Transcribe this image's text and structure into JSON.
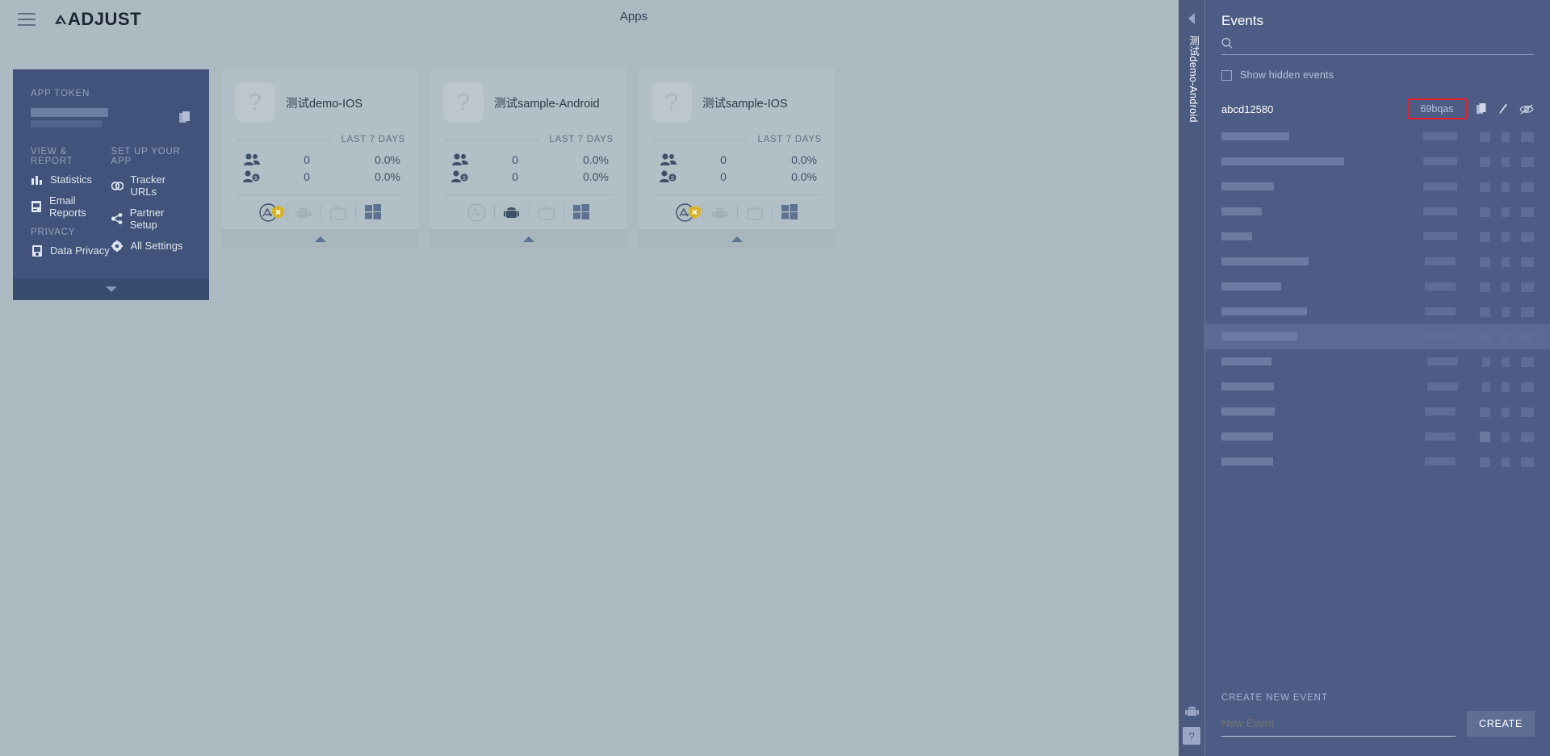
{
  "header": {
    "menu_icon": "hamburger-icon",
    "logo_text": "ADJUST",
    "page_title": "Apps"
  },
  "info_card": {
    "app_token_label": "APP TOKEN",
    "copy_icon": "copy-icon",
    "columns": [
      {
        "heading": "VIEW & REPORT",
        "items": [
          {
            "icon": "bar-chart-icon",
            "label": "Statistics"
          },
          {
            "icon": "email-report-icon",
            "label": "Email Reports"
          }
        ],
        "heading2": "PRIVACY",
        "items2": [
          {
            "icon": "data-privacy-icon",
            "label": "Data Privacy"
          }
        ]
      },
      {
        "heading": "SET UP YOUR APP",
        "items": [
          {
            "icon": "link-icon",
            "label": "Tracker URLs"
          },
          {
            "icon": "share-icon",
            "label": "Partner Setup"
          },
          {
            "icon": "gear-icon",
            "label": "All Settings"
          }
        ]
      }
    ],
    "expand_icon": "chevron-down-icon"
  },
  "apps": [
    {
      "name": "测试demo-IOS",
      "icon": "question-mark-placeholder-icon",
      "period": "LAST 7 DAYS",
      "stats": [
        {
          "icon": "users-icon",
          "value": "0",
          "percent": "0.0%"
        },
        {
          "icon": "paying-user-icon",
          "value": "0",
          "percent": "0.0%"
        }
      ],
      "platforms": [
        "app-store-icon",
        "android-icon",
        "amazon-store-icon",
        "windows-store-icon"
      ],
      "platform_warning": true,
      "expand_icon": "chevron-up-icon"
    },
    {
      "name": "测试sample-Android",
      "icon": "question-mark-placeholder-icon",
      "period": "LAST 7 DAYS",
      "stats": [
        {
          "icon": "users-icon",
          "value": "0",
          "percent": "0.0%"
        },
        {
          "icon": "paying-user-icon",
          "value": "0",
          "percent": "0.0%"
        }
      ],
      "platforms": [
        "app-store-icon",
        "android-icon",
        "amazon-store-icon",
        "windows-store-icon"
      ],
      "platform_warning": false,
      "expand_icon": "chevron-up-icon"
    },
    {
      "name": "测试sample-IOS",
      "icon": "question-mark-placeholder-icon",
      "period": "LAST 7 DAYS",
      "stats": [
        {
          "icon": "users-icon",
          "value": "0",
          "percent": "0.0%"
        },
        {
          "icon": "paying-user-icon",
          "value": "0",
          "percent": "0.0%"
        }
      ],
      "platforms": [
        "app-store-icon",
        "android-icon",
        "amazon-store-icon",
        "windows-store-icon"
      ],
      "platform_warning": true,
      "expand_icon": "chevron-up-icon"
    }
  ],
  "rail": {
    "collapse_icon": "collapse-left-arrow-icon",
    "app_label": "测试demo-Android",
    "android_icon": "android-icon",
    "help_label": "?"
  },
  "events_panel": {
    "title": "Events",
    "search_icon": "search-icon",
    "search_value": "",
    "search_placeholder": "",
    "show_hidden_label": "Show hidden events",
    "show_hidden_checked": false,
    "highlight_color": "#e8202a",
    "rows": [
      {
        "name": "abcd12580",
        "token": "69bqas",
        "redacted": false,
        "selected": false,
        "actions": [
          "copy-icon",
          "edit-pencil-icon",
          "eye-hidden-icon"
        ]
      },
      {
        "name": "",
        "token": "",
        "redacted": true,
        "selected": false,
        "redact_w": 84,
        "actions": []
      },
      {
        "name": "",
        "token": "",
        "redacted": true,
        "selected": false,
        "redact_w": 152,
        "actions": []
      },
      {
        "name": "",
        "token": "",
        "redacted": true,
        "selected": false,
        "redact_w": 65,
        "actions": []
      },
      {
        "name": "",
        "token": "",
        "redacted": true,
        "selected": false,
        "redact_w": 50,
        "actions": []
      },
      {
        "name": "",
        "token": "",
        "redacted": true,
        "selected": false,
        "redact_w": 38,
        "actions": []
      },
      {
        "name": "",
        "token": "",
        "redacted": true,
        "selected": false,
        "redact_w": 108,
        "actions": []
      },
      {
        "name": "",
        "token": "",
        "redacted": true,
        "selected": false,
        "redact_w": 74,
        "actions": []
      },
      {
        "name": "",
        "token": "",
        "redacted": true,
        "selected": false,
        "redact_w": 106,
        "actions": []
      },
      {
        "name": "",
        "token": "",
        "redacted": true,
        "selected": true,
        "redact_w": 94,
        "actions": []
      },
      {
        "name": "",
        "token": "",
        "redacted": true,
        "selected": false,
        "redact_w": 62,
        "actions": []
      },
      {
        "name": "",
        "token": "",
        "redacted": true,
        "selected": false,
        "redact_w": 65,
        "actions": []
      },
      {
        "name": "",
        "token": "",
        "redacted": true,
        "selected": false,
        "redact_w": 66,
        "actions": []
      },
      {
        "name": "",
        "token": "",
        "redacted": true,
        "selected": false,
        "redact_w": 64,
        "actions": []
      },
      {
        "name": "",
        "token": "",
        "redacted": true,
        "selected": false,
        "redact_w": 64,
        "actions": []
      }
    ],
    "create_label": "CREATE NEW EVENT",
    "create_value": "New Event",
    "create_placeholder": "New Event",
    "create_button": "CREATE"
  }
}
